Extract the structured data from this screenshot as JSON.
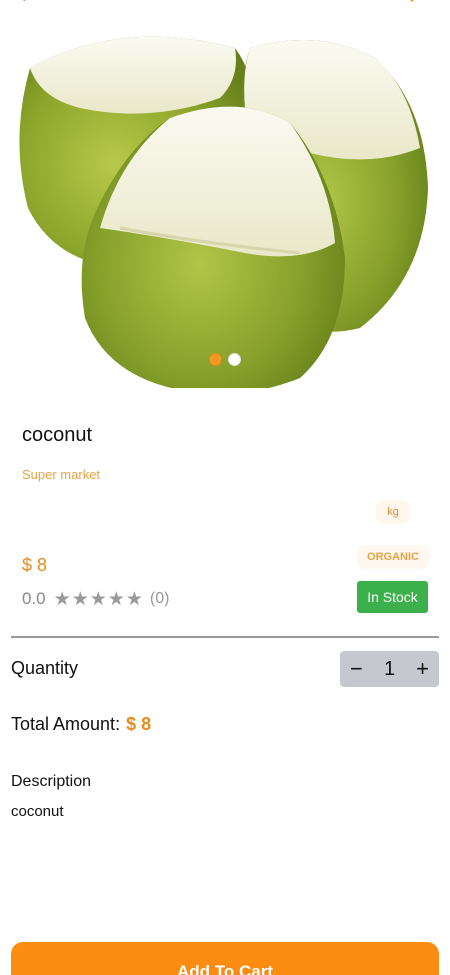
{
  "topbar": {
    "back_icon": "back-arrow-icon",
    "cart_icon": "cart-icon"
  },
  "carousel": {
    "image_count": 2,
    "active_index": 0
  },
  "product": {
    "name": "coconut",
    "store": "Super market",
    "unit": "kg",
    "tag": "ORGANIC",
    "price": "$ 8",
    "rating": "0.0",
    "rating_count": "(0)",
    "star_count": 5,
    "stock": "In Stock"
  },
  "quantity": {
    "label": "Quantity",
    "minus": "−",
    "value": "1",
    "plus": "+"
  },
  "total": {
    "label": "Total Amount:",
    "value": "$ 8"
  },
  "description": {
    "heading": "Description",
    "text": "coconut"
  },
  "actions": {
    "add_to_cart": "Add To Cart"
  },
  "colors": {
    "accent": "#fb8c12",
    "price": "#e98b1c",
    "stock": "#3cb04a",
    "stepper_bg": "#c5c9cf"
  }
}
